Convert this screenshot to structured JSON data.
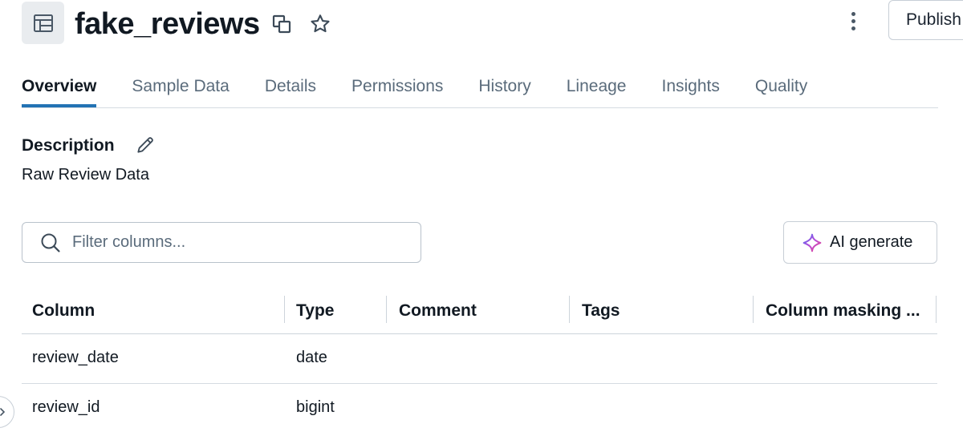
{
  "header": {
    "title": "fake_reviews",
    "publish_label": "Publish",
    "icons": [
      "table-icon",
      "copy-icon",
      "star-icon",
      "kebab-menu-icon"
    ]
  },
  "tabs": [
    {
      "label": "Overview",
      "active": true
    },
    {
      "label": "Sample Data",
      "active": false
    },
    {
      "label": "Details",
      "active": false
    },
    {
      "label": "Permissions",
      "active": false
    },
    {
      "label": "History",
      "active": false
    },
    {
      "label": "Lineage",
      "active": false
    },
    {
      "label": "Insights",
      "active": false
    },
    {
      "label": "Quality",
      "active": false
    }
  ],
  "description": {
    "label": "Description",
    "text": "Raw Review Data"
  },
  "filter": {
    "placeholder": "Filter columns...",
    "value": ""
  },
  "ai_generate": {
    "label": "AI generate"
  },
  "table": {
    "columns": [
      "Column",
      "Type",
      "Comment",
      "Tags",
      "Column masking ..."
    ],
    "rows": [
      [
        "review_date",
        "date",
        "",
        "",
        ""
      ],
      [
        "review_id",
        "bigint",
        "",
        "",
        ""
      ]
    ]
  },
  "colors": {
    "accent": "#2272b4",
    "text": "#111922",
    "muted": "#5a6b7b",
    "border": "#c7ced6"
  }
}
